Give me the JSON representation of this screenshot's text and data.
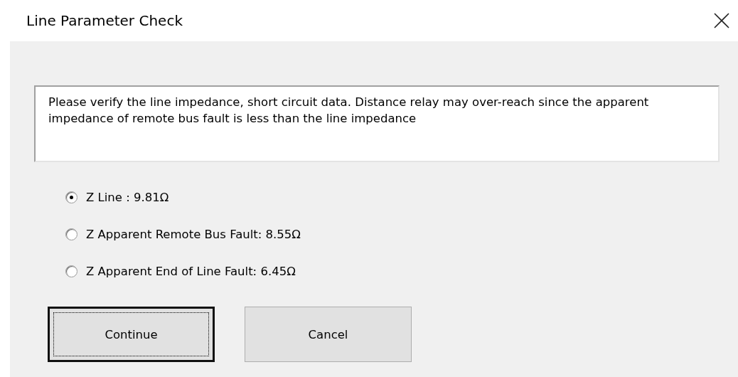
{
  "window": {
    "title": "Line Parameter Check"
  },
  "message": "Please verify the line impedance, short circuit data. Distance relay may over-reach since the apparent impedance of remote bus fault is less than the line impedance",
  "options": [
    {
      "label": "Z Line : 9.81Ω",
      "selected": true
    },
    {
      "label": "Z Apparent Remote Bus Fault: 8.55Ω",
      "selected": false
    },
    {
      "label": "Z Apparent End of Line Fault: 6.45Ω",
      "selected": false
    }
  ],
  "buttons": [
    {
      "label": "Continue",
      "focused": true
    },
    {
      "label": "Cancel",
      "focused": false
    }
  ]
}
